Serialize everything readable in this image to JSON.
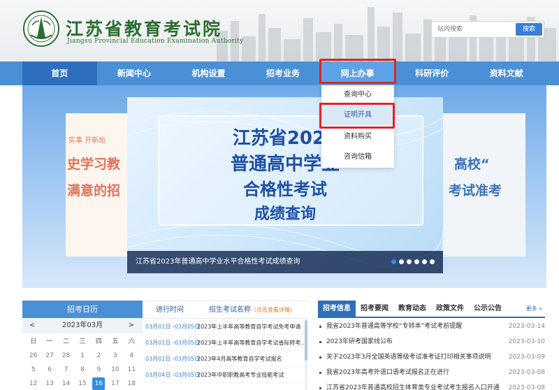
{
  "header": {
    "site_title": "江苏省教育考试院",
    "site_subtitle": "Jiangsu Provincial Education Examination Authority",
    "search_placeholder": "站内搜索",
    "search_button": "搜索"
  },
  "nav": {
    "items": [
      {
        "label": "首页"
      },
      {
        "label": "新闻中心"
      },
      {
        "label": "机构设置"
      },
      {
        "label": "招考业务"
      },
      {
        "label": "网上办事"
      },
      {
        "label": "科研评价"
      },
      {
        "label": "资料文献"
      }
    ]
  },
  "dropdown": {
    "items": [
      {
        "label": "查询中心"
      },
      {
        "label": "证明开具"
      },
      {
        "label": "资料购买"
      },
      {
        "label": "咨询信箱"
      }
    ]
  },
  "hero": {
    "left_card": {
      "small": "实事 开新局",
      "line1": "史学习教",
      "line2": "满意的招"
    },
    "right_card": {
      "line1": "高校“",
      "line2": "考试准考"
    },
    "slide": {
      "line1": "江苏省2023",
      "line2": "普通高中学业",
      "line3": "合格性考试",
      "line4": "成绩查询",
      "caption": "江苏省2023年普通高中学业水平合格性考试成绩查询"
    },
    "dot_count": 6,
    "active_dot": 0
  },
  "calendar": {
    "title": "招考日历",
    "month": "2023年03月",
    "prev": "<",
    "next": ">",
    "weekdays": [
      "日",
      "一",
      "二",
      "三",
      "四",
      "五",
      "六"
    ],
    "rows": [
      [
        "26",
        "27",
        "28",
        "1",
        "2",
        "3",
        "4"
      ],
      [
        "5",
        "6",
        "7",
        "8",
        "9",
        "10",
        "11"
      ],
      [
        "12",
        "13",
        "14",
        "15",
        "16",
        "17",
        "18"
      ]
    ],
    "today": "16"
  },
  "exams": {
    "col_time": "进行时间",
    "col_name": "招生考试名称",
    "col_tag": "（点击查看详情）",
    "rows": [
      {
        "date": "03月01日 -03月05日",
        "name": "2023年上半年高等教育自学考试免考申请"
      },
      {
        "date": "03月01日 -03月05日",
        "name": "2023年上半年高等教育自学考试省际转考..."
      },
      {
        "date": "03月01日 -03月05日",
        "name": "2023年4月高等教育自学考试报名"
      },
      {
        "date": "03月04日 -03月05日",
        "name": "2023年中职职教高考专业技能考试"
      }
    ]
  },
  "news": {
    "tabs": [
      {
        "label": "招考信息"
      },
      {
        "label": "招考要闻"
      },
      {
        "label": "教育动态"
      },
      {
        "label": "政策文件"
      },
      {
        "label": "公示公告"
      }
    ],
    "more": "更多 »",
    "items": [
      {
        "title": "我省2023年普通高等学校“专转本”考试考前提醒",
        "date": "2023-03-14"
      },
      {
        "title": "2023年研考国家线公布",
        "date": "2023-03-10"
      },
      {
        "title": "关于2023年3月全国英语等级考试准考证打印相关事项说明",
        "date": "2023-03-09"
      },
      {
        "title": "我省2023年高考外语口语考试报名正在进行",
        "date": "2023-03-08"
      },
      {
        "title": "江苏省2023年普通高校招生体育类专业考试考生报名入口开通",
        "date": "2023-03-08"
      }
    ]
  }
}
